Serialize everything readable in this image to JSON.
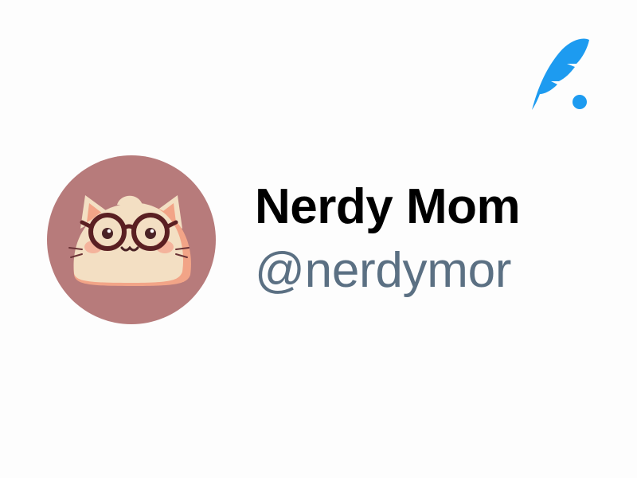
{
  "profile": {
    "display_name": "Nerdy Mom",
    "handle": "@nerdymor",
    "avatar": "cat-with-glasses-avatar"
  },
  "logo": {
    "icon": "quill-feather-icon",
    "color": "#1d9bf0"
  },
  "colors": {
    "name": "#000000",
    "handle": "#5b7083",
    "avatar_bg": "#b77b7b",
    "accent": "#1d9bf0"
  }
}
